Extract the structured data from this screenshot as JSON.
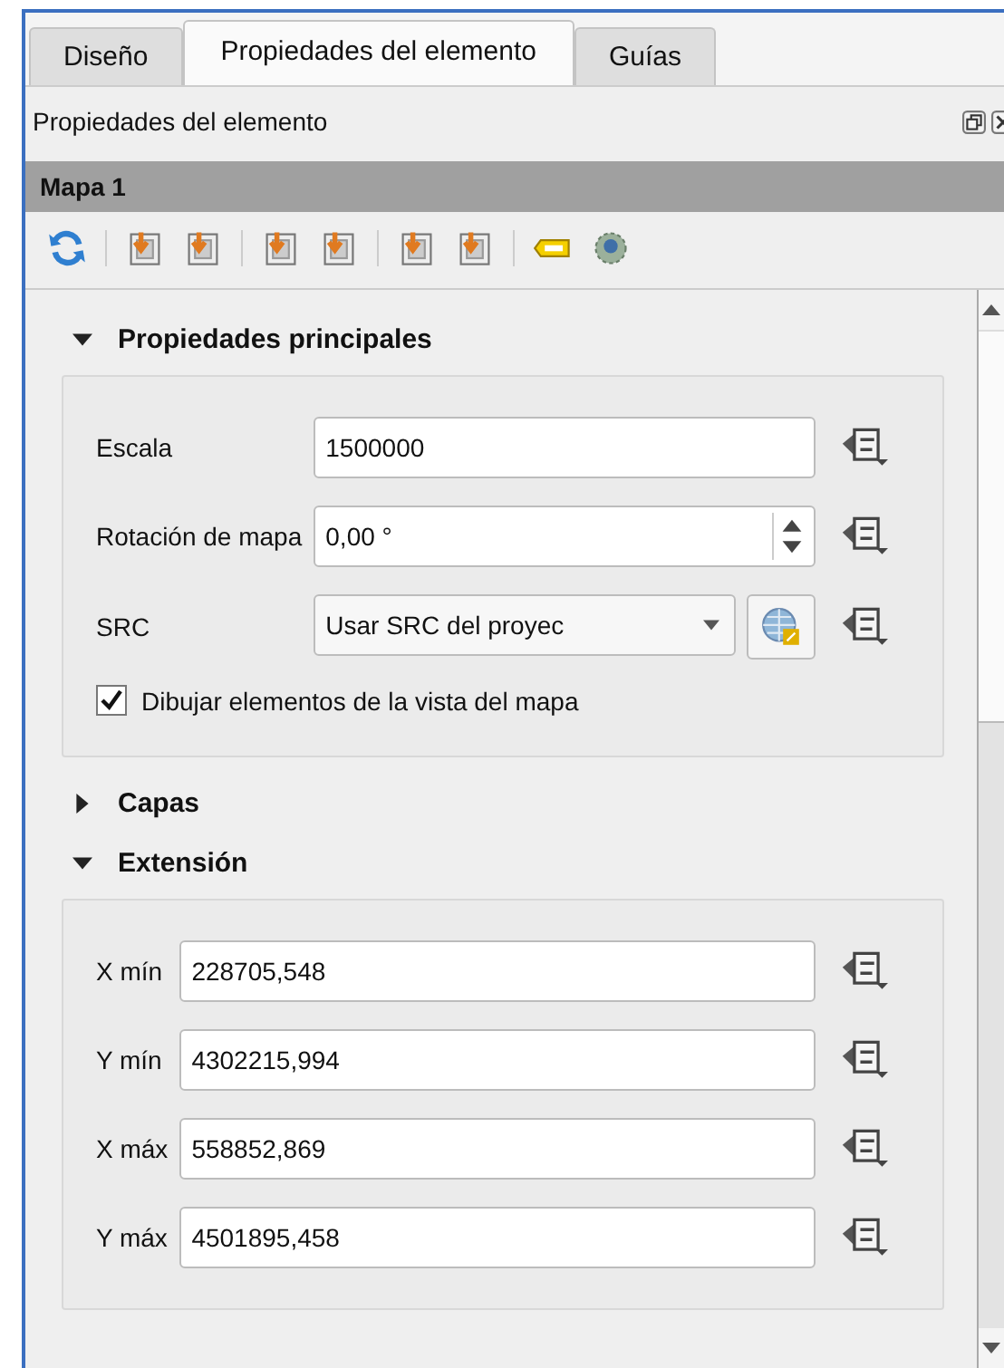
{
  "tabs": [
    {
      "label": "Diseño",
      "selected": false
    },
    {
      "label": "Propiedades del elemento",
      "selected": true
    },
    {
      "label": "Guías",
      "selected": false
    }
  ],
  "panel": {
    "title": "Propiedades del elemento"
  },
  "item_header": "Mapa 1",
  "sections": [
    {
      "title": "Propiedades principales",
      "expanded": true,
      "fields": [
        {
          "kind": "text",
          "label": "Escala",
          "value": "1500000"
        },
        {
          "kind": "spin",
          "label": "Rotación de mapa",
          "value": "0,00 °"
        },
        {
          "kind": "combo",
          "label": "SRC",
          "value": "Usar SRC del proyec"
        }
      ],
      "checkbox": {
        "label": "Dibujar elementos de la vista del mapa",
        "checked": true
      }
    },
    {
      "title": "Capas",
      "expanded": false
    },
    {
      "title": "Extensión",
      "expanded": true,
      "fields": [
        {
          "kind": "text",
          "label": "X mín",
          "value": "228705,548"
        },
        {
          "kind": "text",
          "label": "Y mín",
          "value": "4302215,994"
        },
        {
          "kind": "text",
          "label": "X máx",
          "value": "558852,869"
        },
        {
          "kind": "text",
          "label": "Y máx",
          "value": "4501895,458"
        }
      ]
    }
  ]
}
